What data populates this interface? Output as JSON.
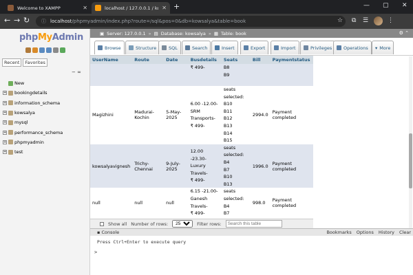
{
  "browser": {
    "tabs": [
      {
        "title": "Welcome to XAMPP",
        "color": "#8a5a3a"
      },
      {
        "title": "localhost / 127.0.0.1 / kowsalya /",
        "color": "#f89c0e"
      }
    ],
    "url_host": "localhost",
    "url_path": "/phpmyadmin/index.php?route=/sql&pos=0&db=kowsalya&table=book"
  },
  "sidebar": {
    "logo": {
      "php": "php",
      "my": "My",
      "admin": "Admin"
    },
    "tabs": [
      "Recent",
      "Favorites"
    ],
    "collapse_label": "− ∞",
    "items": [
      {
        "label": "New",
        "type": "new"
      },
      {
        "label": "bookingdetails",
        "type": "db"
      },
      {
        "label": "information_schema",
        "type": "db"
      },
      {
        "label": "kowsalya",
        "type": "db"
      },
      {
        "label": "mysql",
        "type": "db"
      },
      {
        "label": "performance_schema",
        "type": "db"
      },
      {
        "label": "phpmyadmin",
        "type": "db"
      },
      {
        "label": "test",
        "type": "db"
      }
    ]
  },
  "breadcrumb": {
    "server": "Server: 127.0.0.1",
    "database": "Database: kowsalya",
    "table": "Table: book"
  },
  "menu_tabs": [
    {
      "label": "Browse",
      "icon": "browse-icon",
      "color": "#5a7fa6"
    },
    {
      "label": "Structure",
      "icon": "structure-icon",
      "color": "#7a9cb8"
    },
    {
      "label": "SQL",
      "icon": "sql-icon",
      "color": "#7a8a9a"
    },
    {
      "label": "Search",
      "icon": "search-icon",
      "color": "#5b7a9a"
    },
    {
      "label": "Insert",
      "icon": "insert-icon",
      "color": "#4d7aa3"
    },
    {
      "label": "Export",
      "icon": "export-icon",
      "color": "#5a7fa6"
    },
    {
      "label": "Import",
      "icon": "import-icon",
      "color": "#5a7fa6"
    },
    {
      "label": "Privileges",
      "icon": "privileges-icon",
      "color": "#6f86a0"
    },
    {
      "label": "Operations",
      "icon": "operations-icon",
      "color": "#5a7fa6"
    },
    {
      "label": "More",
      "icon": "chevron-down-icon",
      "color": "#555555"
    }
  ],
  "table": {
    "headers": [
      "UserName",
      "Route",
      "Date",
      "Busdetails",
      "Seats",
      "Bill",
      "Paymentstatus"
    ],
    "rows": [
      {
        "username": "",
        "route": "",
        "date": "",
        "busdetails": [
          "₹ 499-"
        ],
        "seats": [
          "B8",
          "B9"
        ],
        "bill": "",
        "status": ""
      },
      {
        "username": "Magizhini",
        "route": "Madurai-Kochin",
        "date": "5-May-2025",
        "busdetails": [
          "6.00 -12.00-",
          "SRM Transports-",
          "₹ 499-"
        ],
        "seats": [
          "seats selected:",
          "B10",
          "B11",
          "B12",
          "B13",
          "B14",
          "B15"
        ],
        "bill": "2994.0",
        "status": "Payment completed"
      },
      {
        "username": "kowsalyavignesh",
        "route": "Trichy-Chennai",
        "date": "9-July-2025",
        "busdetails": [
          "12.00 -23.30-",
          "Luxury Travels-",
          "₹ 499-"
        ],
        "seats": [
          "seats selected:",
          "B4",
          "B7",
          "B10",
          "B13"
        ],
        "bill": "1996.0",
        "status": "Payment completed"
      },
      {
        "username": "null",
        "route": "null",
        "date": "null",
        "busdetails": [
          "6.15 -21.00-",
          "Ganesh Travels-",
          "₹ 499-"
        ],
        "seats": [
          "seats selected:",
          "B4",
          "B7"
        ],
        "bill": "998.0",
        "status": "Payment completed"
      }
    ]
  },
  "filter": {
    "show_all": "Show all",
    "rows_label": "Number of rows:",
    "rows_value": "25",
    "filter_label": "Filter rows:",
    "filter_placeholder": "Search this table"
  },
  "console": {
    "title": "Console",
    "actions": [
      "Bookmarks",
      "Options",
      "History",
      "Clear"
    ],
    "hint": "Press Ctrl+Enter to execute query",
    "prompt": ">"
  }
}
